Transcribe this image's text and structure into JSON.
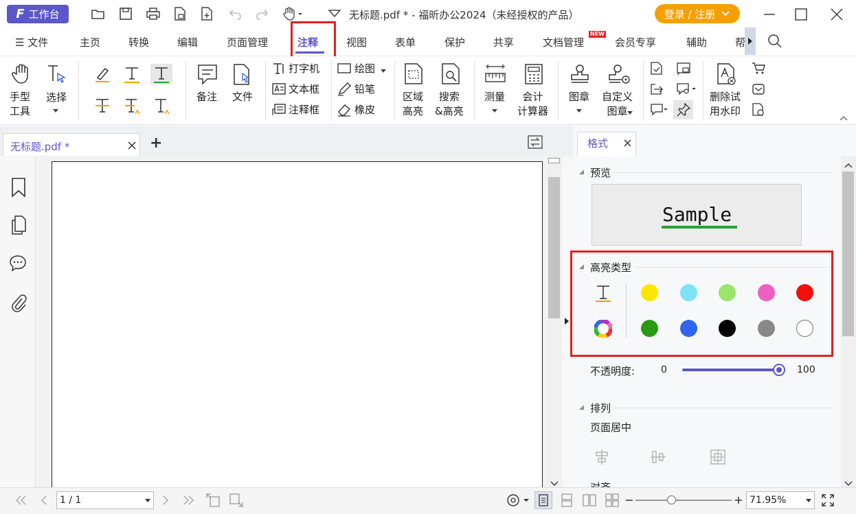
{
  "titlebar": {
    "workbench_label": "工作台",
    "workbench_logo": "F",
    "doc_title": "无标题.pdf * - 福昕办公2024（未经授权的产品）",
    "login_label": "登录 / 注册",
    "login_color": "#f5a000",
    "accent_color": "#5b57c9"
  },
  "menu": {
    "file": "文件",
    "tabs": [
      "主页",
      "转换",
      "编辑",
      "页面管理",
      "注释",
      "视图",
      "表单",
      "保护",
      "共享",
      "文档管理",
      "会员专享",
      "辅助",
      "帮"
    ],
    "active_tab": "注释",
    "new_badge": "NEW"
  },
  "ribbon": {
    "hand_tool": [
      "手型",
      "工具"
    ],
    "select": "选择",
    "note": "备注",
    "file": "文件",
    "typewriter": "打字机",
    "textbox": "文本框",
    "callout": "注释框",
    "drawing": "绘图",
    "pencil": "铅笔",
    "eraser": "橡皮",
    "area_highlight": [
      "区域",
      "高亮"
    ],
    "search_highlight": [
      "搜索",
      "&高亮"
    ],
    "measure": "测量",
    "calculator": [
      "会计",
      "计算器"
    ],
    "stamp": "图章",
    "custom_stamp": [
      "自定义",
      "图章"
    ],
    "remove_watermark": [
      "删除试",
      "用水印"
    ]
  },
  "doc_tab": {
    "label": "无标题.pdf *",
    "add": "+"
  },
  "format_panel": {
    "tab_label": "格式",
    "preview_title": "预览",
    "sample_text": "Sample",
    "highlight_type_title": "高亮类型",
    "colors": [
      "#ffe600",
      "#7fe3f7",
      "#99e66b",
      "#ee5fc4",
      "#f40f0f",
      "#2a9a14",
      "#2f66ee",
      "#000000",
      "#888888",
      "#ffffff"
    ],
    "opacity_label": "不透明度:",
    "opacity_min": "0",
    "opacity_max": "100",
    "opacity_value": 100,
    "arrange_title": "排列",
    "page_center": "页面居中",
    "next_section": "对齐"
  },
  "statusbar": {
    "page_value": "1 / 1",
    "zoom_value": "71.95%"
  }
}
